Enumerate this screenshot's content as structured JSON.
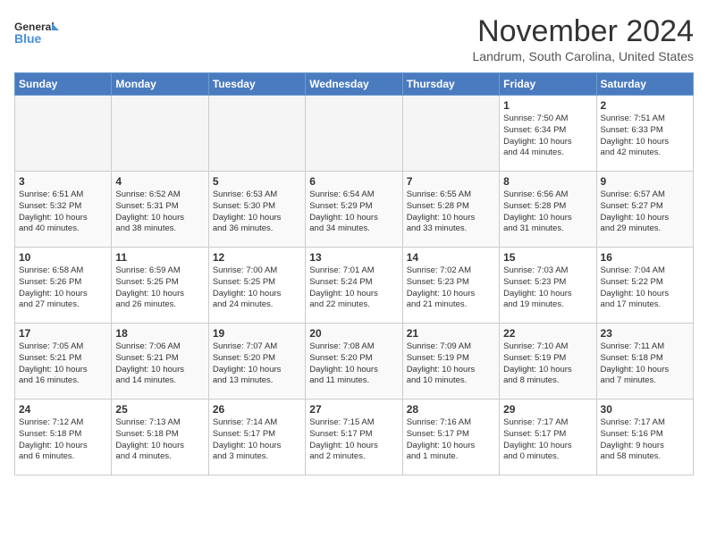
{
  "header": {
    "logo_line1": "General",
    "logo_line2": "Blue",
    "title": "November 2024",
    "subtitle": "Landrum, South Carolina, United States"
  },
  "weekdays": [
    "Sunday",
    "Monday",
    "Tuesday",
    "Wednesday",
    "Thursday",
    "Friday",
    "Saturday"
  ],
  "weeks": [
    [
      {
        "day": "",
        "info": ""
      },
      {
        "day": "",
        "info": ""
      },
      {
        "day": "",
        "info": ""
      },
      {
        "day": "",
        "info": ""
      },
      {
        "day": "",
        "info": ""
      },
      {
        "day": "1",
        "info": "Sunrise: 7:50 AM\nSunset: 6:34 PM\nDaylight: 10 hours\nand 44 minutes."
      },
      {
        "day": "2",
        "info": "Sunrise: 7:51 AM\nSunset: 6:33 PM\nDaylight: 10 hours\nand 42 minutes."
      }
    ],
    [
      {
        "day": "3",
        "info": "Sunrise: 6:51 AM\nSunset: 5:32 PM\nDaylight: 10 hours\nand 40 minutes."
      },
      {
        "day": "4",
        "info": "Sunrise: 6:52 AM\nSunset: 5:31 PM\nDaylight: 10 hours\nand 38 minutes."
      },
      {
        "day": "5",
        "info": "Sunrise: 6:53 AM\nSunset: 5:30 PM\nDaylight: 10 hours\nand 36 minutes."
      },
      {
        "day": "6",
        "info": "Sunrise: 6:54 AM\nSunset: 5:29 PM\nDaylight: 10 hours\nand 34 minutes."
      },
      {
        "day": "7",
        "info": "Sunrise: 6:55 AM\nSunset: 5:28 PM\nDaylight: 10 hours\nand 33 minutes."
      },
      {
        "day": "8",
        "info": "Sunrise: 6:56 AM\nSunset: 5:28 PM\nDaylight: 10 hours\nand 31 minutes."
      },
      {
        "day": "9",
        "info": "Sunrise: 6:57 AM\nSunset: 5:27 PM\nDaylight: 10 hours\nand 29 minutes."
      }
    ],
    [
      {
        "day": "10",
        "info": "Sunrise: 6:58 AM\nSunset: 5:26 PM\nDaylight: 10 hours\nand 27 minutes."
      },
      {
        "day": "11",
        "info": "Sunrise: 6:59 AM\nSunset: 5:25 PM\nDaylight: 10 hours\nand 26 minutes."
      },
      {
        "day": "12",
        "info": "Sunrise: 7:00 AM\nSunset: 5:25 PM\nDaylight: 10 hours\nand 24 minutes."
      },
      {
        "day": "13",
        "info": "Sunrise: 7:01 AM\nSunset: 5:24 PM\nDaylight: 10 hours\nand 22 minutes."
      },
      {
        "day": "14",
        "info": "Sunrise: 7:02 AM\nSunset: 5:23 PM\nDaylight: 10 hours\nand 21 minutes."
      },
      {
        "day": "15",
        "info": "Sunrise: 7:03 AM\nSunset: 5:23 PM\nDaylight: 10 hours\nand 19 minutes."
      },
      {
        "day": "16",
        "info": "Sunrise: 7:04 AM\nSunset: 5:22 PM\nDaylight: 10 hours\nand 17 minutes."
      }
    ],
    [
      {
        "day": "17",
        "info": "Sunrise: 7:05 AM\nSunset: 5:21 PM\nDaylight: 10 hours\nand 16 minutes."
      },
      {
        "day": "18",
        "info": "Sunrise: 7:06 AM\nSunset: 5:21 PM\nDaylight: 10 hours\nand 14 minutes."
      },
      {
        "day": "19",
        "info": "Sunrise: 7:07 AM\nSunset: 5:20 PM\nDaylight: 10 hours\nand 13 minutes."
      },
      {
        "day": "20",
        "info": "Sunrise: 7:08 AM\nSunset: 5:20 PM\nDaylight: 10 hours\nand 11 minutes."
      },
      {
        "day": "21",
        "info": "Sunrise: 7:09 AM\nSunset: 5:19 PM\nDaylight: 10 hours\nand 10 minutes."
      },
      {
        "day": "22",
        "info": "Sunrise: 7:10 AM\nSunset: 5:19 PM\nDaylight: 10 hours\nand 8 minutes."
      },
      {
        "day": "23",
        "info": "Sunrise: 7:11 AM\nSunset: 5:18 PM\nDaylight: 10 hours\nand 7 minutes."
      }
    ],
    [
      {
        "day": "24",
        "info": "Sunrise: 7:12 AM\nSunset: 5:18 PM\nDaylight: 10 hours\nand 6 minutes."
      },
      {
        "day": "25",
        "info": "Sunrise: 7:13 AM\nSunset: 5:18 PM\nDaylight: 10 hours\nand 4 minutes."
      },
      {
        "day": "26",
        "info": "Sunrise: 7:14 AM\nSunset: 5:17 PM\nDaylight: 10 hours\nand 3 minutes."
      },
      {
        "day": "27",
        "info": "Sunrise: 7:15 AM\nSunset: 5:17 PM\nDaylight: 10 hours\nand 2 minutes."
      },
      {
        "day": "28",
        "info": "Sunrise: 7:16 AM\nSunset: 5:17 PM\nDaylight: 10 hours\nand 1 minute."
      },
      {
        "day": "29",
        "info": "Sunrise: 7:17 AM\nSunset: 5:17 PM\nDaylight: 10 hours\nand 0 minutes."
      },
      {
        "day": "30",
        "info": "Sunrise: 7:17 AM\nSunset: 5:16 PM\nDaylight: 9 hours\nand 58 minutes."
      }
    ]
  ]
}
